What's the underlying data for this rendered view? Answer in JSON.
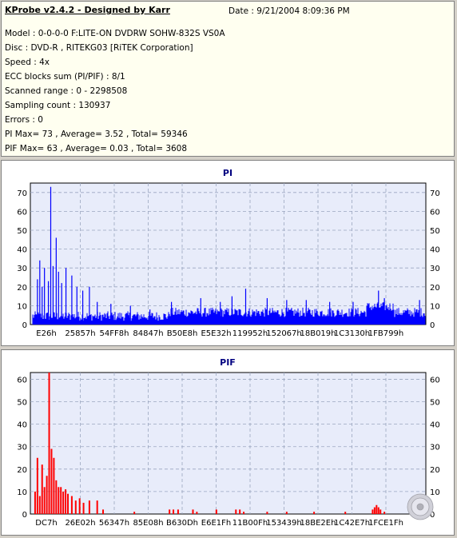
{
  "header": {
    "title": "KProbe v2.4.2 - Designed by Karr",
    "date": "Date : 9/21/2004 8:09:36 PM",
    "lines": [
      "Model : 0-0-0-0 F:LITE-ON DVDRW SOHW-832S  VS0A",
      "Disc : DVD-R , RITEKG03 [RiTEK Corporation]",
      "Speed : 4x",
      "ECC blocks sum (PI/PIF) : 8/1",
      "Scanned range : 0 - 2298508",
      "Sampling count : 130937",
      "Errors : 0",
      "PI Max= 73 , Average= 3.52 , Total= 59346",
      "PIF Max= 63 , Average= 0.03 , Total= 3608"
    ]
  },
  "colors": {
    "pi": "#0000ff",
    "pif": "#ff0000",
    "plot_bg": "#e8ecfa",
    "grid": "#9aa6c0"
  },
  "chart_data": [
    {
      "type": "bar",
      "title": "PI",
      "ylim": [
        0,
        75
      ],
      "yticks": [
        0,
        10,
        20,
        30,
        40,
        50,
        60,
        70
      ],
      "xtick_labels": [
        "E26h",
        "25857h",
        "54FF8h",
        "84847h",
        "B50E8h",
        "E5E32h",
        "119952h",
        "152067h",
        "18B019h",
        "1C3130h",
        "1FB799h"
      ],
      "grid": true,
      "baseline": 4,
      "noise": 5,
      "spikes": [
        {
          "x": 0.012,
          "y": 24
        },
        {
          "x": 0.018,
          "y": 34
        },
        {
          "x": 0.024,
          "y": 20
        },
        {
          "x": 0.03,
          "y": 30
        },
        {
          "x": 0.04,
          "y": 23
        },
        {
          "x": 0.046,
          "y": 73
        },
        {
          "x": 0.052,
          "y": 31
        },
        {
          "x": 0.06,
          "y": 46
        },
        {
          "x": 0.066,
          "y": 28
        },
        {
          "x": 0.074,
          "y": 22
        },
        {
          "x": 0.085,
          "y": 30
        },
        {
          "x": 0.1,
          "y": 26
        },
        {
          "x": 0.113,
          "y": 20
        },
        {
          "x": 0.128,
          "y": 18
        },
        {
          "x": 0.145,
          "y": 20
        },
        {
          "x": 0.165,
          "y": 12
        },
        {
          "x": 0.2,
          "y": 11
        },
        {
          "x": 0.25,
          "y": 10
        },
        {
          "x": 0.3,
          "y": 8
        },
        {
          "x": 0.355,
          "y": 12
        },
        {
          "x": 0.43,
          "y": 14
        },
        {
          "x": 0.48,
          "y": 12
        },
        {
          "x": 0.51,
          "y": 15
        },
        {
          "x": 0.545,
          "y": 19
        },
        {
          "x": 0.6,
          "y": 14
        },
        {
          "x": 0.65,
          "y": 13
        },
        {
          "x": 0.7,
          "y": 13
        },
        {
          "x": 0.76,
          "y": 12
        },
        {
          "x": 0.82,
          "y": 12
        },
        {
          "x": 0.885,
          "y": 18
        },
        {
          "x": 0.9,
          "y": 14
        },
        {
          "x": 0.99,
          "y": 13
        }
      ]
    },
    {
      "type": "bar",
      "title": "PIF",
      "ylim": [
        0,
        63
      ],
      "yticks": [
        0,
        10,
        20,
        30,
        40,
        50,
        60
      ],
      "xtick_labels": [
        "DC7h",
        "26E02h",
        "56347h",
        "85E08h",
        "B630Dh",
        "E6E1Fh",
        "11B00Fh",
        "153439h",
        "18BE2Eh",
        "1C42E7h",
        "1FCE1Fh"
      ],
      "grid": true,
      "baseline": 0,
      "noise": 0,
      "spikes": [
        {
          "x": 0.006,
          "y": 10
        },
        {
          "x": 0.012,
          "y": 25
        },
        {
          "x": 0.018,
          "y": 8
        },
        {
          "x": 0.024,
          "y": 22
        },
        {
          "x": 0.03,
          "y": 12
        },
        {
          "x": 0.036,
          "y": 17
        },
        {
          "x": 0.042,
          "y": 63
        },
        {
          "x": 0.048,
          "y": 29
        },
        {
          "x": 0.054,
          "y": 25
        },
        {
          "x": 0.06,
          "y": 15
        },
        {
          "x": 0.066,
          "y": 12
        },
        {
          "x": 0.072,
          "y": 12
        },
        {
          "x": 0.078,
          "y": 10
        },
        {
          "x": 0.084,
          "y": 11
        },
        {
          "x": 0.09,
          "y": 9
        },
        {
          "x": 0.1,
          "y": 8
        },
        {
          "x": 0.11,
          "y": 6
        },
        {
          "x": 0.12,
          "y": 7
        },
        {
          "x": 0.13,
          "y": 5
        },
        {
          "x": 0.145,
          "y": 6
        },
        {
          "x": 0.165,
          "y": 6
        },
        {
          "x": 0.18,
          "y": 2
        },
        {
          "x": 0.26,
          "y": 1
        },
        {
          "x": 0.35,
          "y": 2
        },
        {
          "x": 0.36,
          "y": 2
        },
        {
          "x": 0.372,
          "y": 2
        },
        {
          "x": 0.41,
          "y": 2
        },
        {
          "x": 0.42,
          "y": 1
        },
        {
          "x": 0.47,
          "y": 2
        },
        {
          "x": 0.52,
          "y": 2
        },
        {
          "x": 0.53,
          "y": 2
        },
        {
          "x": 0.54,
          "y": 1
        },
        {
          "x": 0.6,
          "y": 1
        },
        {
          "x": 0.65,
          "y": 1
        },
        {
          "x": 0.72,
          "y": 1
        },
        {
          "x": 0.8,
          "y": 1
        },
        {
          "x": 0.87,
          "y": 2
        },
        {
          "x": 0.875,
          "y": 3
        },
        {
          "x": 0.88,
          "y": 4
        },
        {
          "x": 0.885,
          "y": 3
        },
        {
          "x": 0.89,
          "y": 2
        },
        {
          "x": 0.9,
          "y": 1
        }
      ]
    }
  ]
}
